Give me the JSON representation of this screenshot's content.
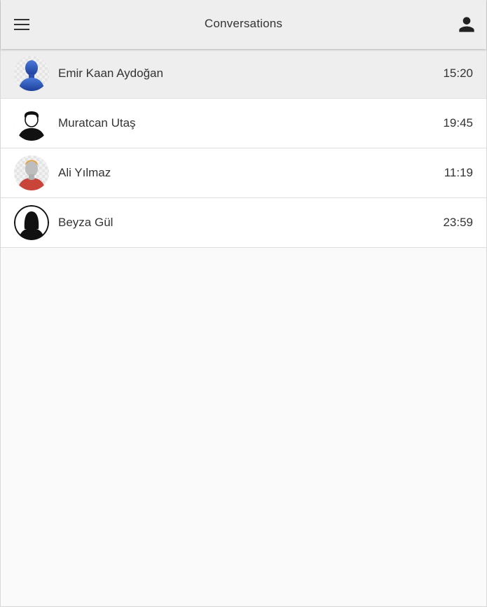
{
  "header": {
    "title": "Conversations",
    "menu_icon": "menu-icon",
    "profile_icon": "person-icon"
  },
  "conversations": [
    {
      "name": "Emir Kaan Aydoğan",
      "time": "15:20",
      "avatar": "avatar-blue-man",
      "active": true
    },
    {
      "name": "Muratcan Utaş",
      "time": "19:45",
      "avatar": "avatar-man-black",
      "active": false
    },
    {
      "name": "Ali Yılmaz",
      "time": "11:19",
      "avatar": "avatar-grey-man-red-shirt",
      "active": false
    },
    {
      "name": "Beyza Gül",
      "time": "23:59",
      "avatar": "avatar-woman-silhouette",
      "active": false
    }
  ],
  "colors": {
    "header_bg": "#eeeeee",
    "active_row_bg": "#eeeeee",
    "page_bg": "#fafafa",
    "text": "#333333"
  }
}
